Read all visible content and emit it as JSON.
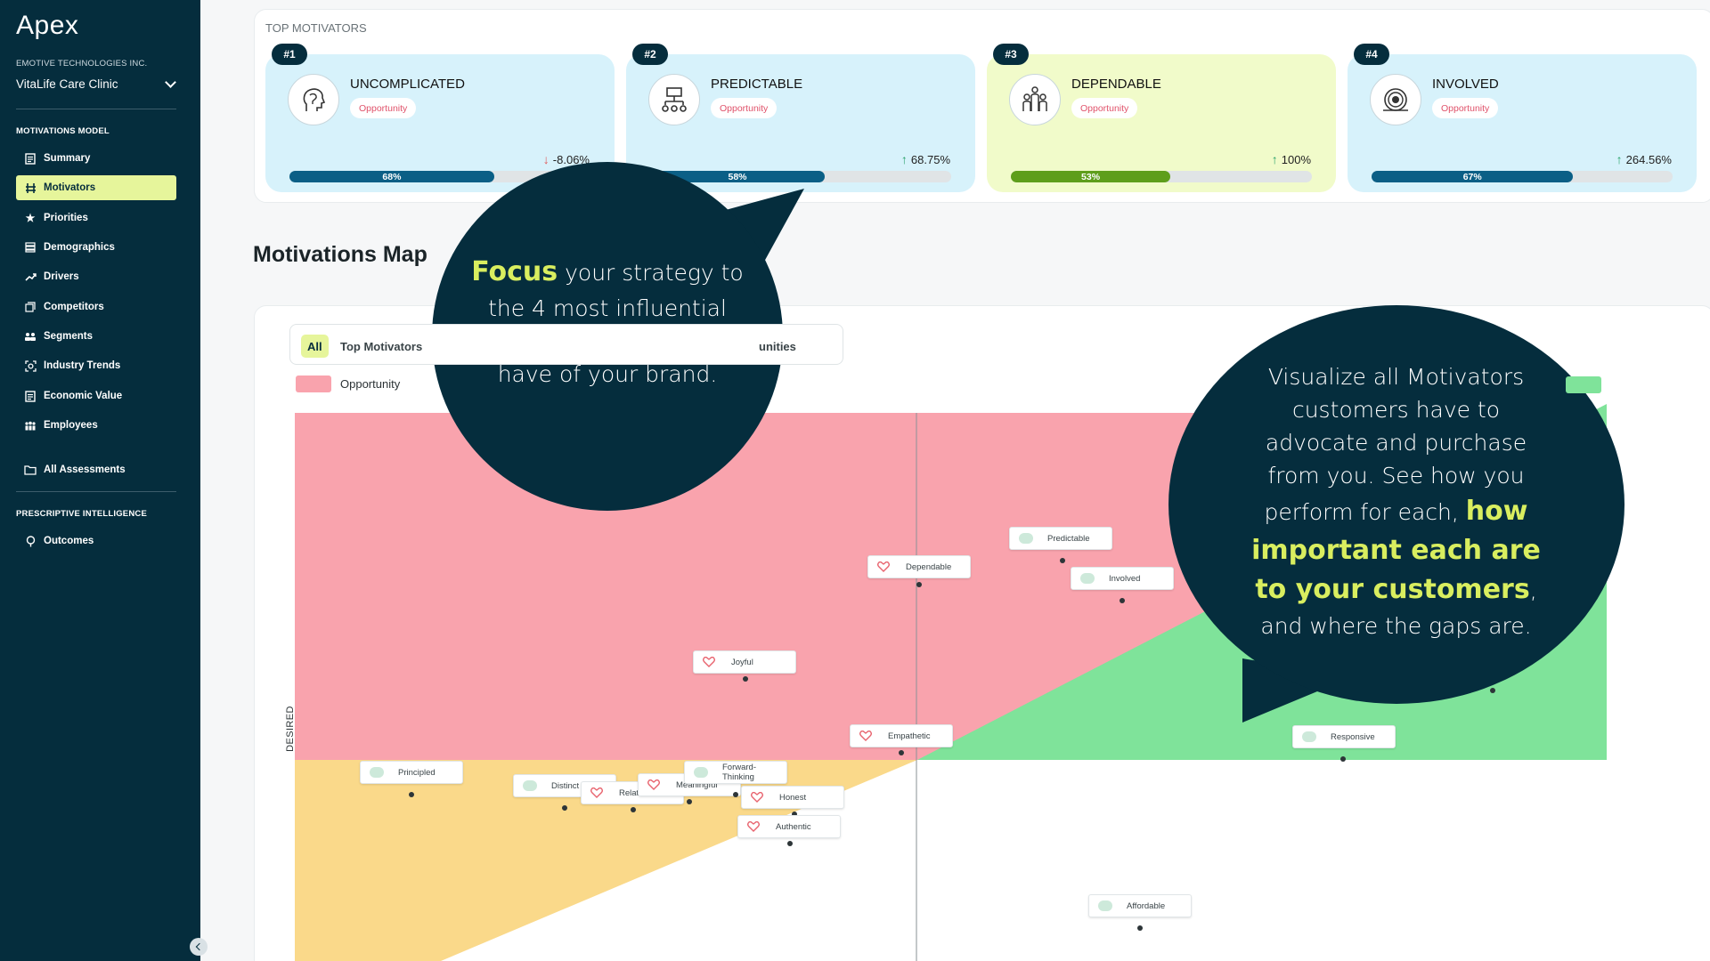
{
  "sidebar": {
    "logo": "Apex",
    "org": "EMOTIVE TECHNOLOGIES INC.",
    "clinic": "VitaLife Care Clinic",
    "section_model": "MOTIVATIONS MODEL",
    "section_prescriptive": "PRESCRIPTIVE INTELLIGENCE",
    "items": [
      {
        "label": "Summary",
        "icon": "document-icon"
      },
      {
        "label": "Motivators",
        "icon": "sliders-icon"
      },
      {
        "label": "Priorities",
        "icon": "star-icon"
      },
      {
        "label": "Demographics",
        "icon": "list-icon"
      },
      {
        "label": "Drivers",
        "icon": "trend-icon"
      },
      {
        "label": "Competitors",
        "icon": "compare-icon"
      },
      {
        "label": "Segments",
        "icon": "people-icon"
      },
      {
        "label": "Industry Trends",
        "icon": "scan-icon"
      },
      {
        "label": "Economic Value",
        "icon": "document-icon"
      },
      {
        "label": "Employees",
        "icon": "group-icon"
      }
    ],
    "all_assessments": "All Assessments",
    "outcomes": "Outcomes"
  },
  "top": {
    "title": "TOP MOTIVATORS",
    "cards": [
      {
        "rank": "#1",
        "name": "UNCOMPLICATED",
        "tag": "Opportunity",
        "change": "-8.06%",
        "direction": "down",
        "progress": 68,
        "progress_label": "68%",
        "icon": "head-icon",
        "color": "#d7f2fb"
      },
      {
        "rank": "#2",
        "name": "PREDICTABLE",
        "tag": "Opportunity",
        "change": "68.75%",
        "direction": "up",
        "progress": 58,
        "progress_label": "58%",
        "icon": "hierarchy-icon",
        "color": "#d7f2fb"
      },
      {
        "rank": "#3",
        "name": "DEPENDABLE",
        "tag": "Opportunity",
        "change": "100%",
        "direction": "up",
        "progress": 53,
        "progress_label": "53%",
        "icon": "people-group-icon",
        "color": "#f1fbca"
      },
      {
        "rank": "#4",
        "name": "INVOLVED",
        "tag": "Opportunity",
        "change": "264.56%",
        "direction": "up",
        "progress": 67,
        "progress_label": "67%",
        "icon": "target-icon",
        "color": "#d7f2fb"
      }
    ]
  },
  "map": {
    "heading": "Motivations Map",
    "filters": [
      "All",
      "Top Motivators",
      "unities"
    ],
    "legend_opportunity": "Opportunity",
    "axis_label": "DESIRED",
    "colors": {
      "opportunity": "#f9a3ad",
      "strength": "#7fe39a",
      "other": "#fad98a"
    },
    "labels": [
      {
        "text": "Predictable",
        "icon": "bubble"
      },
      {
        "text": "Dependable",
        "icon": "heart"
      },
      {
        "text": "Involved",
        "icon": "bubble"
      },
      {
        "text": "Joyful",
        "icon": "heart"
      },
      {
        "text": "Empathetic",
        "icon": "heart"
      },
      {
        "text": "Responsive",
        "icon": "bubble"
      },
      {
        "text": "Principled",
        "icon": "bubble"
      },
      {
        "text": "Distinct",
        "icon": "bubble"
      },
      {
        "text": "Relatable",
        "icon": "heart"
      },
      {
        "text": "Meaningful",
        "icon": "heart"
      },
      {
        "text": "Forward-Thinking",
        "icon": "bubble"
      },
      {
        "text": "Honest",
        "icon": "heart"
      },
      {
        "text": "Authentic",
        "icon": "heart"
      },
      {
        "text": "Affordable",
        "icon": "bubble"
      }
    ]
  },
  "callouts": {
    "one_highlight": "Focus",
    "one_rest": " your strategy to the 4 most influential Motivators your customers have of your brand.",
    "two_start": "Visualize all Motivators customers have to advocate and purchase from you. See how you perform for each, ",
    "two_highlight": "how important each are to your customers",
    "two_end": ", and where the gaps are."
  }
}
